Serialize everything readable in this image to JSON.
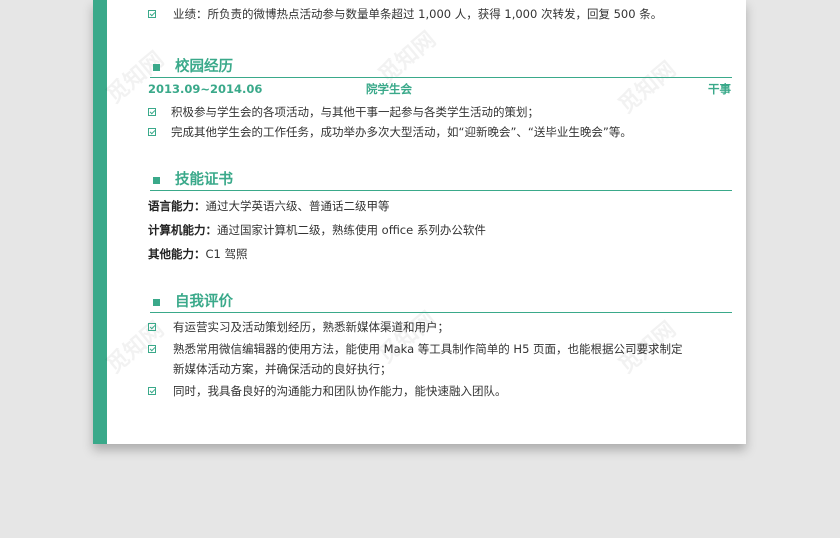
{
  "top_item": {
    "text": "业绩：所负责的微博热点活动参与数量单条超过 1,000 人，获得 1,000 次转发，回复 500 条。"
  },
  "campus": {
    "title": "校园经历",
    "period": "2013.09~2014.06",
    "org": "院学生会",
    "role": "干事",
    "items": [
      "积极参与学生会的各项活动，与其他干事一起参与各类学生活动的策划；",
      "完成其他学生会的工作任务，成功举办多次大型活动，如“迎新晚会”、“送毕业生晚会”等。"
    ]
  },
  "skills": {
    "title": "技能证书",
    "rows": [
      {
        "label": "语言能力：",
        "value": "通过大学英语六级、普通话二级甲等"
      },
      {
        "label": "计算机能力：",
        "value": "通过国家计算机二级，熟练使用 office 系列办公软件"
      },
      {
        "label": "其他能力：",
        "value": "C1 驾照"
      }
    ]
  },
  "self_eval": {
    "title": "自我评价",
    "items": [
      "有运营实习及活动策划经历，熟悉新媒体渠道和用户；",
      "熟悉常用微信编辑器的使用方法，能使用 Maka 等工具制作简单的 H5 页面，也能根据公司要求制定",
      "新媒体活动方案，并确保活动的良好执行；",
      "同时，我具备良好的沟通能力和团队协作能力，能快速融入团队。"
    ]
  },
  "watermark": {
    "text": "觅知网"
  },
  "colors": {
    "accent": "#3aa98a",
    "sidebar": "#3aa98a",
    "background": "#e6e6e6"
  }
}
